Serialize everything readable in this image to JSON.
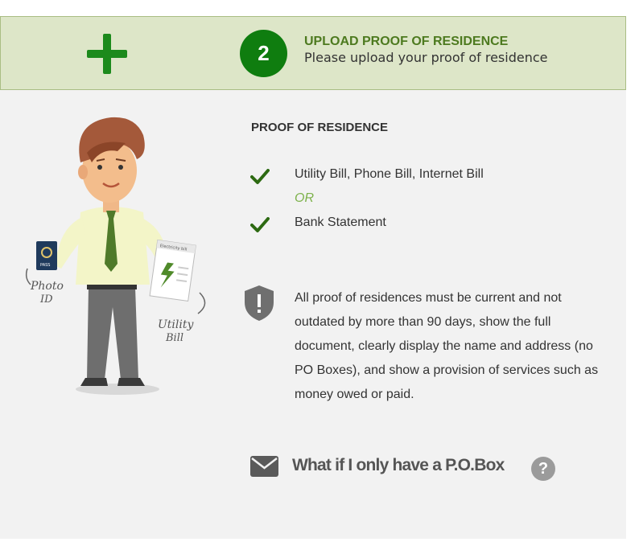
{
  "header": {
    "step_number": "2",
    "title": "UPLOAD PROOF OF RESIDENCE",
    "subtitle": "Please upload your proof of residence",
    "icon": "plus-icon"
  },
  "illustration": {
    "passport_label": "PASS",
    "photo_id_label_line1": "Photo",
    "photo_id_label_line2": "ID",
    "bill_header": "Electricity bill",
    "utility_label_line1": "Utility",
    "utility_label_line2": "Bill"
  },
  "proof": {
    "title": "PROOF OF RESIDENCE",
    "item1": "Utility Bill, Phone Bill, Internet Bill",
    "or_text": "OR",
    "item2": "Bank Statement",
    "check_icon": "check-icon"
  },
  "notice": {
    "icon": "shield-alert-icon",
    "text": "All proof of residences must be current and not outdated by more than 90 days, show the full document, clearly display the name and address (no PO Boxes), and show a provision of services such as money owed or paid."
  },
  "pobox": {
    "icon": "mail-icon",
    "label": "What if I only have a P.O.Box",
    "help_icon": "question-mark-icon",
    "help_glyph": "?"
  },
  "colors": {
    "header_bg": "#dde6c8",
    "accent_green": "#0f7d0f",
    "title_green": "#4d7a1f",
    "or_green": "#7db24b",
    "panel_bg": "#f2f2f2"
  }
}
